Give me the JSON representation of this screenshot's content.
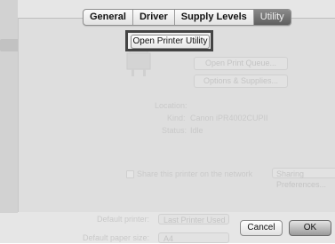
{
  "tabs": [
    {
      "label": "General",
      "active": false
    },
    {
      "label": "Driver",
      "active": false
    },
    {
      "label": "Supply Levels",
      "active": false
    },
    {
      "label": "Utility",
      "active": true
    }
  ],
  "main": {
    "open_utility_label": "Open Printer Utility"
  },
  "background": {
    "open_print_queue": "Open Print Queue...",
    "options_supplies": "Options & Supplies...",
    "location_label": "Location:",
    "kind_label": "Kind:",
    "kind_value": "Canon iPR4002CUPII",
    "status_label": "Status:",
    "status_value": "Idle",
    "share_label": "Share this printer on the network",
    "sharing_prefs": "Sharing Preferences...",
    "default_printer_label": "Default printer:",
    "default_printer_value": "Last Printer Used",
    "default_paper_label": "Default paper size:",
    "default_paper_value": "A4"
  },
  "footer": {
    "cancel_label": "Cancel",
    "ok_label": "OK"
  }
}
